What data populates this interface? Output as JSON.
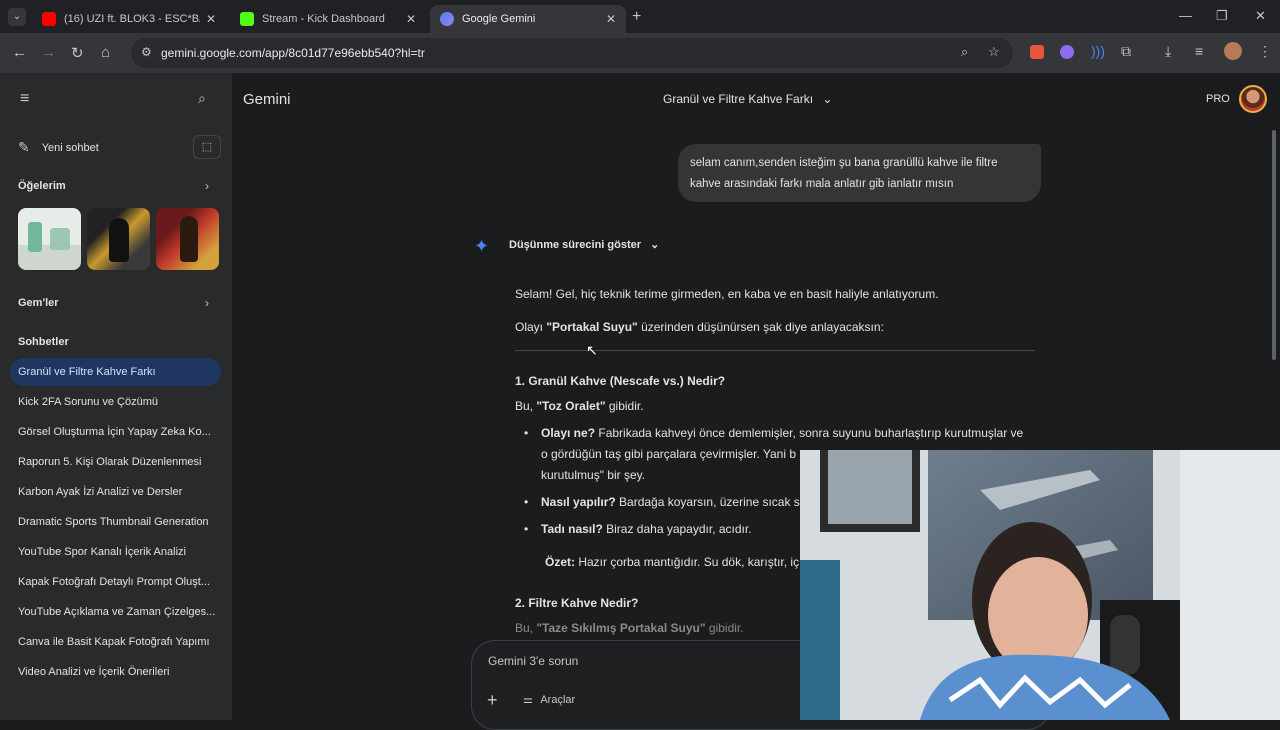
{
  "browser": {
    "tabs": [
      {
        "title": "(16) UZI ft. BLOK3 - ESC*BAR 2.0",
        "favicon_color": "#ff0000"
      },
      {
        "title": "Stream - Kick Dashboard",
        "favicon_color": "#53fc18"
      },
      {
        "title": "Google Gemini",
        "favicon_color": "#4a86f0"
      }
    ],
    "url": "gemini.google.com/app/8c01d77e96ebb540?hl=tr"
  },
  "sidebar": {
    "new_chat": "Yeni sohbet",
    "items_heading": "Öğelerim",
    "gems_heading": "Gem'ler",
    "chats_heading": "Sohbetler",
    "chats": [
      "Granül ve Filtre Kahve Farkı",
      "Kick 2FA Sorunu ve Çözümü",
      "Görsel Oluşturma İçin Yapay Zeka Ko...",
      "Raporun 5. Kişi Olarak Düzenlenmesi",
      "Karbon Ayak İzi Analizi ve Dersler",
      "Dramatic Sports Thumbnail Generation",
      "YouTube Spor Kanalı İçerik Analizi",
      "Kapak Fotoğrafı Detaylı Prompt Oluşt...",
      "YouTube Açıklama ve Zaman Çizelges...",
      "Canva ile Basit Kapak Fotoğrafı Yapımı",
      "Video Analizi ve İçerik Önerileri"
    ]
  },
  "header": {
    "brand": "Gemini",
    "conversation_title": "Granül ve Filtre Kahve Farkı",
    "plan": "PRO"
  },
  "conversation": {
    "user_message": "selam canım,senden isteğim şu bana granüllü kahve ile filtre kahve arasındaki farkı mala anlatır gib ianlatır mısın",
    "thinking_toggle": "Düşünme sürecini göster",
    "intro": "Selam! Gel, hiç teknik terime girmeden, en kaba ve en basit haliyle anlatıyorum.",
    "analogy_pre": "Olayı ",
    "analogy_bold": "\"Portakal Suyu\"",
    "analogy_post": " üzerinden düşünürsen şak diye anlayacaksın:",
    "section1_title": "1. Granül Kahve (Nescafe vs.) Nedir?",
    "section1_pre": "Bu, ",
    "section1_bold": "\"Toz Oralet\"",
    "section1_post": " gibidir.",
    "b1_label": "Olayı ne?",
    "b1_text1": " Fabrikada kahveyi önce demlemişler, sonra suyunu buharlaştırıp kurutmuşlar ve",
    "b1_text2": "o gördüğün taş gibi parçalara çevirmişler. Yani b",
    "b1_text3": "kurutulmuş\" bir şey.",
    "b2_label": "Nasıl yapılır?",
    "b2_text": " Bardağa koyarsın, üzerine sıcak s",
    "b3_label": "Tadı nasıl?",
    "b3_text": " Biraz daha yapaydır, acıdır.",
    "summary_label": "Özet:",
    "summary_text": " Hazır çorba mantığıdır. Su dök, karıştır, iç",
    "section2_title": "2. Filtre Kahve Nedir?",
    "section2_pre": "Bu, ",
    "section2_bold": "\"Taze Sıkılmış Portakal Suyu\"",
    "section2_post": " gibidir."
  },
  "composer": {
    "placeholder": "Gemini 3'e sorun",
    "tools_label": "Araçlar"
  }
}
